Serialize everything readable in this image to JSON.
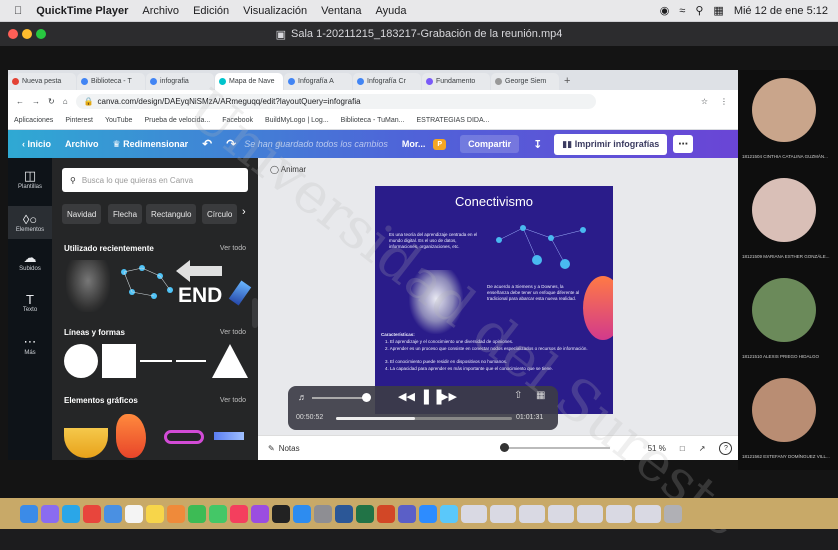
{
  "menubar": {
    "app": "QuickTime Player",
    "items": [
      "Archivo",
      "Edición",
      "Visualización",
      "Ventana",
      "Ayuda"
    ],
    "datetime": "Mié 12 de ene  5:12"
  },
  "window": {
    "title": "Sala 1-20211215_183217-Grabación de la reunión.mp4"
  },
  "browser": {
    "tabs": [
      "Nueva pesta",
      "Biblioteca - T",
      "infografia",
      "Mapa de Nave",
      "Infografía A",
      "Infografía Cr",
      "Fundamento",
      "George Siem"
    ],
    "url": "canva.com/design/DAEyqNiSMzA/ARmeguqq/edit?layoutQuery=infografia",
    "bookmarks": [
      "Aplicaciones",
      "Pinterest",
      "YouTube",
      "Prueba de velocida...",
      "Facebook",
      "BuildMyLogo | Log...",
      "Biblioteca - TuMan...",
      "ESTRATEGIAS DIDA..."
    ]
  },
  "canva": {
    "toolbar": {
      "home": "Inicio",
      "file": "Archivo",
      "resize": "Redimensionar",
      "saved": "Se han guardado todos los cambios",
      "more": "Mor...",
      "share": "Compartir",
      "print": "Imprimir infografías"
    },
    "nav": [
      {
        "label": "Plantillas",
        "icon": "templates-icon"
      },
      {
        "label": "Elementos",
        "icon": "elements-icon"
      },
      {
        "label": "Subidos",
        "icon": "upload-icon"
      },
      {
        "label": "Texto",
        "icon": "text-icon"
      },
      {
        "label": "Más",
        "icon": "more-icon"
      }
    ],
    "search_placeholder": "Busca lo que quieras en Canva",
    "chips": [
      "Navidad",
      "Flecha",
      "Rectangulo",
      "Círculo"
    ],
    "sections": [
      {
        "title": "Utilizado recientemente",
        "link": "Ver todo"
      },
      {
        "title": "Líneas y formas",
        "link": "Ver todo"
      },
      {
        "title": "Elementos gráficos",
        "link": "Ver todo"
      }
    ],
    "end_text": "END",
    "animate": "Animar",
    "notes": "Notas",
    "zoom": "51 %",
    "help": "?"
  },
  "slide": {
    "title": "Conectivismo",
    "p1": "Es una teoría del aprendizaje centrada en el mundo digital. Es el uso de datos, informaciones, organizaciones, etc.",
    "p2": "De acuerdo a Siemens y a Downes, la enseñanza debe tener un enfoque diferente al tradicional para abarcar esta nueva realidad.",
    "char_title": "Características:",
    "items": [
      "1. El aprendizaje y el conocimiento une diversidad de opiniones.",
      "2. Aprender es un proceso que consiste en conectar nodos especializados o recursos de información.",
      "3. El conocimiento puede residir en dispositivos no humanos.",
      "4. La capacidad para aprender es más importante que el conocimiento que se tiene."
    ]
  },
  "player": {
    "elapsed": "00:50:52",
    "remaining": "01:01:31",
    "progress": 0.45
  },
  "participants": [
    {
      "name": "18121504 CINTHIA CATALINA GUZMÁN...",
      "color": "#c9a58b"
    },
    {
      "name": "18121509 MARIANA ESTHER GONZÁLE...",
      "color": "#d9bfb7"
    },
    {
      "name": "18121510 ALEXIS PRIEGO HIDALGO",
      "color": "#6b8a5a"
    },
    {
      "name": "18121562 ESTEFANY DOMÍNGUEZ VILL...",
      "color": "#b98d73"
    }
  ],
  "watermark": "Universidad del Sureste",
  "colors": {
    "canva_grad_start": "#2fa9d3",
    "canva_grad_end": "#6a45d6",
    "slide_bg": "#2a1c8a",
    "panel_bg": "#252627"
  }
}
